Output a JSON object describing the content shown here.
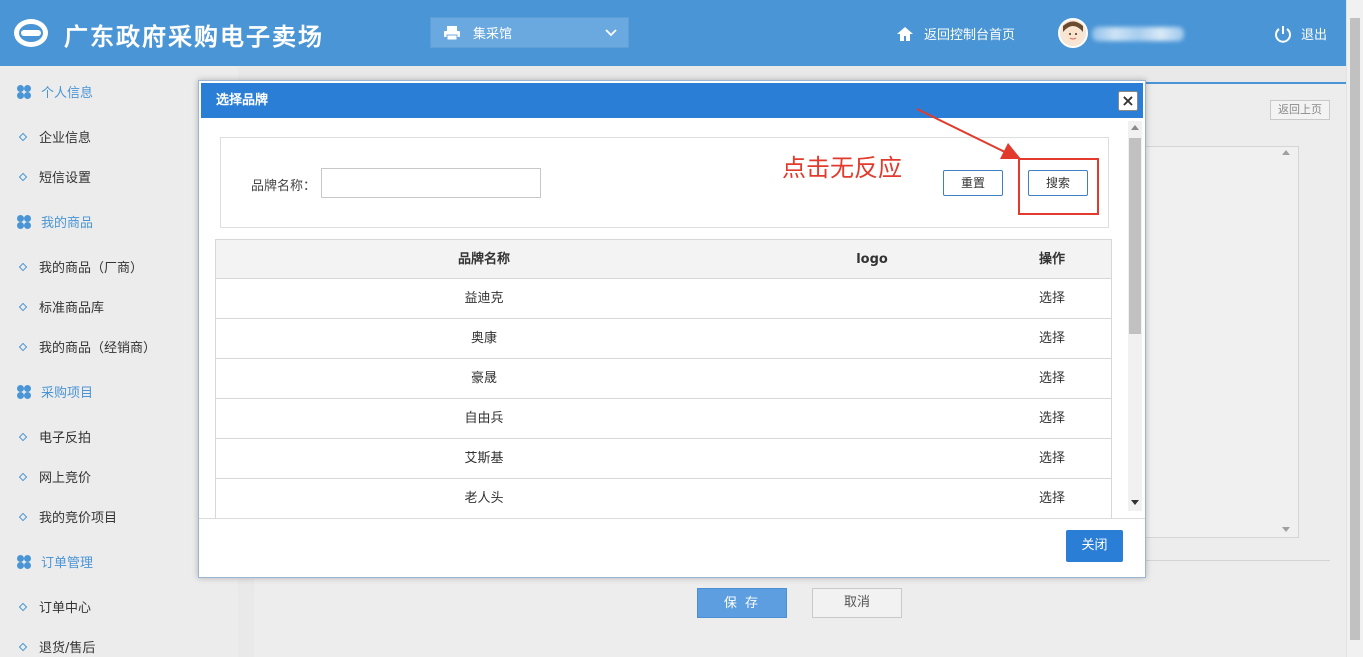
{
  "header": {
    "site_title": "广东政府采购电子卖场",
    "hall_select": "集采馆",
    "home_link": "返回控制台首页",
    "logout": "退出",
    "colors": {
      "bar": "#4a95d6",
      "accent": "#2a7ed5",
      "annotation": "#e23a2c"
    }
  },
  "sidebar": {
    "groups": [
      {
        "label": "个人信息",
        "items": [
          "企业信息",
          "短信设置"
        ]
      },
      {
        "label": "我的商品",
        "items": [
          "我的商品（厂商）",
          "标准商品库",
          "我的商品（经销商）"
        ]
      },
      {
        "label": "采购项目",
        "items": [
          "电子反拍",
          "网上竞价",
          "我的竞价项目"
        ]
      },
      {
        "label": "订单管理",
        "items": [
          "订单中心",
          "退货/售后"
        ]
      }
    ]
  },
  "page": {
    "back_button": "返回上页",
    "save_button": "保 存",
    "cancel_button": "取消"
  },
  "modal": {
    "title": "选择品牌",
    "brand_label": "品牌名称：",
    "brand_input_value": "",
    "reset_button": "重置",
    "search_button": "搜索",
    "annotation": "点击无反应",
    "columns": [
      "品牌名称",
      "logo",
      "操作"
    ],
    "rows": [
      {
        "name": "益迪克",
        "logo": "",
        "action": "选择"
      },
      {
        "name": "奥康",
        "logo": "",
        "action": "选择"
      },
      {
        "name": "豪晟",
        "logo": "",
        "action": "选择"
      },
      {
        "name": "自由兵",
        "logo": "",
        "action": "选择"
      },
      {
        "name": "艾斯基",
        "logo": "",
        "action": "选择"
      },
      {
        "name": "老人头",
        "logo": "",
        "action": "选择"
      }
    ],
    "close_button": "关闭"
  }
}
